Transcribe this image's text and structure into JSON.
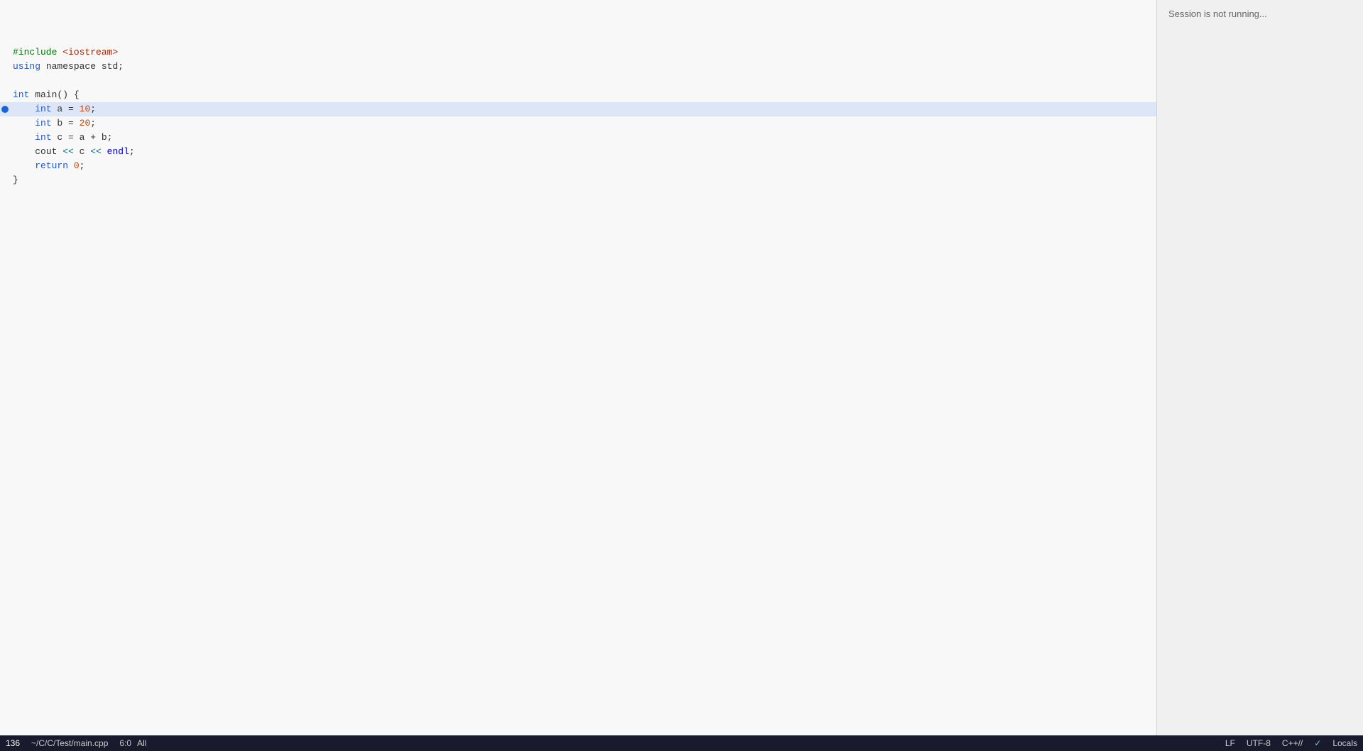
{
  "editor": {
    "lines": [
      {
        "id": 1,
        "hasBreakpoint": false,
        "highlighted": false,
        "tokens": [
          {
            "type": "preprocessor",
            "text": "#include "
          },
          {
            "type": "include-file",
            "text": "<iostream>"
          }
        ]
      },
      {
        "id": 2,
        "hasBreakpoint": false,
        "highlighted": false,
        "tokens": [
          {
            "type": "kw-blue",
            "text": "using"
          },
          {
            "type": "ident",
            "text": " namespace "
          },
          {
            "type": "ident",
            "text": "std"
          },
          {
            "type": "punc",
            "text": ";"
          }
        ]
      },
      {
        "id": 3,
        "hasBreakpoint": false,
        "highlighted": false,
        "tokens": []
      },
      {
        "id": 4,
        "hasBreakpoint": false,
        "highlighted": false,
        "tokens": [
          {
            "type": "kw-blue",
            "text": "int"
          },
          {
            "type": "ident",
            "text": " main"
          },
          {
            "type": "punc",
            "text": "() {"
          }
        ]
      },
      {
        "id": 5,
        "hasBreakpoint": true,
        "highlighted": true,
        "tokens": [
          {
            "type": "ident",
            "text": "    "
          },
          {
            "type": "kw-blue",
            "text": "int"
          },
          {
            "type": "ident",
            "text": " a "
          },
          {
            "type": "op",
            "text": "="
          },
          {
            "type": "ident",
            "text": " "
          },
          {
            "type": "num",
            "text": "10"
          },
          {
            "type": "punc",
            "text": ";"
          }
        ]
      },
      {
        "id": 6,
        "hasBreakpoint": false,
        "highlighted": false,
        "tokens": [
          {
            "type": "ident",
            "text": "    "
          },
          {
            "type": "kw-blue",
            "text": "int"
          },
          {
            "type": "ident",
            "text": " b "
          },
          {
            "type": "op",
            "text": "="
          },
          {
            "type": "ident",
            "text": " "
          },
          {
            "type": "num",
            "text": "20"
          },
          {
            "type": "punc",
            "text": ";"
          }
        ]
      },
      {
        "id": 7,
        "hasBreakpoint": false,
        "highlighted": false,
        "tokens": [
          {
            "type": "ident",
            "text": "    "
          },
          {
            "type": "kw-blue",
            "text": "int"
          },
          {
            "type": "ident",
            "text": " c "
          },
          {
            "type": "op",
            "text": "="
          },
          {
            "type": "ident",
            "text": " a "
          },
          {
            "type": "op",
            "text": "+"
          },
          {
            "type": "ident",
            "text": " b"
          },
          {
            "type": "punc",
            "text": ";"
          }
        ]
      },
      {
        "id": 8,
        "hasBreakpoint": false,
        "highlighted": false,
        "tokens": [
          {
            "type": "ident",
            "text": "    "
          },
          {
            "type": "ident",
            "text": "cout "
          },
          {
            "type": "stream-op",
            "text": "<<"
          },
          {
            "type": "ident",
            "text": " c "
          },
          {
            "type": "stream-op",
            "text": "<<"
          },
          {
            "type": "ident",
            "text": " "
          },
          {
            "type": "endl-kw",
            "text": "endl"
          },
          {
            "type": "punc",
            "text": ";"
          }
        ]
      },
      {
        "id": 9,
        "hasBreakpoint": false,
        "highlighted": false,
        "tokens": [
          {
            "type": "ident",
            "text": "    "
          },
          {
            "type": "kw-blue",
            "text": "return"
          },
          {
            "type": "ident",
            "text": " "
          },
          {
            "type": "num",
            "text": "0"
          },
          {
            "type": "punc",
            "text": ";"
          }
        ]
      },
      {
        "id": 10,
        "hasBreakpoint": false,
        "highlighted": false,
        "tokens": [
          {
            "type": "punc",
            "text": "}"
          }
        ]
      }
    ]
  },
  "debug": {
    "session_status": "Session is not running..."
  },
  "statusbar": {
    "line_col": "136",
    "filepath": "~/C/C/Test/main.cpp",
    "cursor_pos": "6:0",
    "all_label": "All",
    "encoding": "LF",
    "charset": "UTF-8",
    "language": "C++//",
    "check_icon": "✓",
    "locals_label": "Locals"
  }
}
